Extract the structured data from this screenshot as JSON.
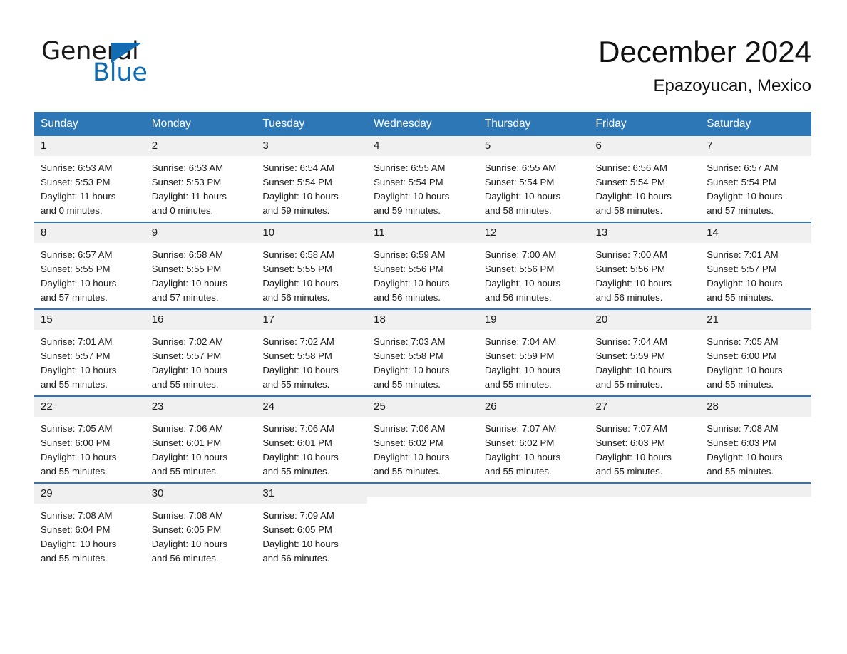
{
  "brand": {
    "line1": "General",
    "line2": "Blue",
    "triangle_icon": "triangle-icon",
    "color_black": "#1a1a1a",
    "color_blue": "#0e6cb4"
  },
  "header": {
    "title": "December 2024",
    "subtitle": "Epazoyucan, Mexico"
  },
  "theme": {
    "header_blue": "#2e77b6",
    "daynum_gray": "#f0f0f0",
    "text": "#1a1a1a"
  },
  "weekdays": [
    "Sunday",
    "Monday",
    "Tuesday",
    "Wednesday",
    "Thursday",
    "Friday",
    "Saturday"
  ],
  "weeks": [
    [
      {
        "day": "1",
        "info": "Sunrise: 6:53 AM\nSunset: 5:53 PM\nDaylight: 11 hours\nand 0 minutes."
      },
      {
        "day": "2",
        "info": "Sunrise: 6:53 AM\nSunset: 5:53 PM\nDaylight: 11 hours\nand 0 minutes."
      },
      {
        "day": "3",
        "info": "Sunrise: 6:54 AM\nSunset: 5:54 PM\nDaylight: 10 hours\nand 59 minutes."
      },
      {
        "day": "4",
        "info": "Sunrise: 6:55 AM\nSunset: 5:54 PM\nDaylight: 10 hours\nand 59 minutes."
      },
      {
        "day": "5",
        "info": "Sunrise: 6:55 AM\nSunset: 5:54 PM\nDaylight: 10 hours\nand 58 minutes."
      },
      {
        "day": "6",
        "info": "Sunrise: 6:56 AM\nSunset: 5:54 PM\nDaylight: 10 hours\nand 58 minutes."
      },
      {
        "day": "7",
        "info": "Sunrise: 6:57 AM\nSunset: 5:54 PM\nDaylight: 10 hours\nand 57 minutes."
      }
    ],
    [
      {
        "day": "8",
        "info": "Sunrise: 6:57 AM\nSunset: 5:55 PM\nDaylight: 10 hours\nand 57 minutes."
      },
      {
        "day": "9",
        "info": "Sunrise: 6:58 AM\nSunset: 5:55 PM\nDaylight: 10 hours\nand 57 minutes."
      },
      {
        "day": "10",
        "info": "Sunrise: 6:58 AM\nSunset: 5:55 PM\nDaylight: 10 hours\nand 56 minutes."
      },
      {
        "day": "11",
        "info": "Sunrise: 6:59 AM\nSunset: 5:56 PM\nDaylight: 10 hours\nand 56 minutes."
      },
      {
        "day": "12",
        "info": "Sunrise: 7:00 AM\nSunset: 5:56 PM\nDaylight: 10 hours\nand 56 minutes."
      },
      {
        "day": "13",
        "info": "Sunrise: 7:00 AM\nSunset: 5:56 PM\nDaylight: 10 hours\nand 56 minutes."
      },
      {
        "day": "14",
        "info": "Sunrise: 7:01 AM\nSunset: 5:57 PM\nDaylight: 10 hours\nand 55 minutes."
      }
    ],
    [
      {
        "day": "15",
        "info": "Sunrise: 7:01 AM\nSunset: 5:57 PM\nDaylight: 10 hours\nand 55 minutes."
      },
      {
        "day": "16",
        "info": "Sunrise: 7:02 AM\nSunset: 5:57 PM\nDaylight: 10 hours\nand 55 minutes."
      },
      {
        "day": "17",
        "info": "Sunrise: 7:02 AM\nSunset: 5:58 PM\nDaylight: 10 hours\nand 55 minutes."
      },
      {
        "day": "18",
        "info": "Sunrise: 7:03 AM\nSunset: 5:58 PM\nDaylight: 10 hours\nand 55 minutes."
      },
      {
        "day": "19",
        "info": "Sunrise: 7:04 AM\nSunset: 5:59 PM\nDaylight: 10 hours\nand 55 minutes."
      },
      {
        "day": "20",
        "info": "Sunrise: 7:04 AM\nSunset: 5:59 PM\nDaylight: 10 hours\nand 55 minutes."
      },
      {
        "day": "21",
        "info": "Sunrise: 7:05 AM\nSunset: 6:00 PM\nDaylight: 10 hours\nand 55 minutes."
      }
    ],
    [
      {
        "day": "22",
        "info": "Sunrise: 7:05 AM\nSunset: 6:00 PM\nDaylight: 10 hours\nand 55 minutes."
      },
      {
        "day": "23",
        "info": "Sunrise: 7:06 AM\nSunset: 6:01 PM\nDaylight: 10 hours\nand 55 minutes."
      },
      {
        "day": "24",
        "info": "Sunrise: 7:06 AM\nSunset: 6:01 PM\nDaylight: 10 hours\nand 55 minutes."
      },
      {
        "day": "25",
        "info": "Sunrise: 7:06 AM\nSunset: 6:02 PM\nDaylight: 10 hours\nand 55 minutes."
      },
      {
        "day": "26",
        "info": "Sunrise: 7:07 AM\nSunset: 6:02 PM\nDaylight: 10 hours\nand 55 minutes."
      },
      {
        "day": "27",
        "info": "Sunrise: 7:07 AM\nSunset: 6:03 PM\nDaylight: 10 hours\nand 55 minutes."
      },
      {
        "day": "28",
        "info": "Sunrise: 7:08 AM\nSunset: 6:03 PM\nDaylight: 10 hours\nand 55 minutes."
      }
    ],
    [
      {
        "day": "29",
        "info": "Sunrise: 7:08 AM\nSunset: 6:04 PM\nDaylight: 10 hours\nand 55 minutes."
      },
      {
        "day": "30",
        "info": "Sunrise: 7:08 AM\nSunset: 6:05 PM\nDaylight: 10 hours\nand 56 minutes."
      },
      {
        "day": "31",
        "info": "Sunrise: 7:09 AM\nSunset: 6:05 PM\nDaylight: 10 hours\nand 56 minutes."
      },
      {
        "day": "",
        "info": ""
      },
      {
        "day": "",
        "info": ""
      },
      {
        "day": "",
        "info": ""
      },
      {
        "day": "",
        "info": ""
      }
    ]
  ]
}
